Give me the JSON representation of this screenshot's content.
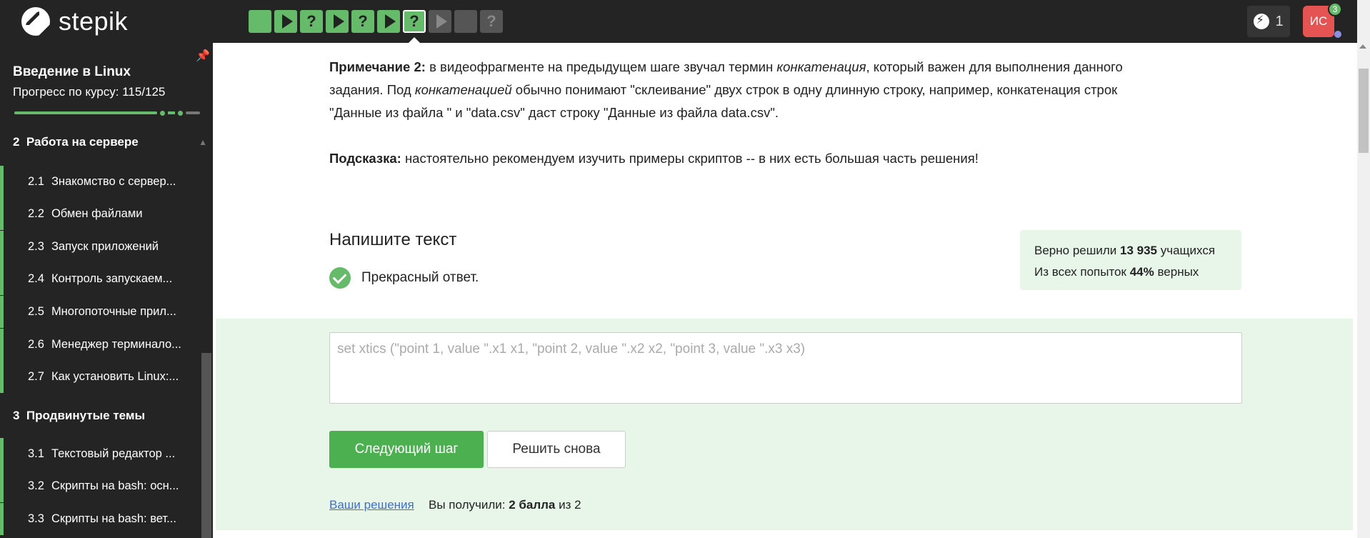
{
  "header": {
    "logo_text": "stepik",
    "steps": [
      {
        "kind": "square",
        "state": "green"
      },
      {
        "kind": "play",
        "state": "green"
      },
      {
        "kind": "question",
        "state": "green",
        "label": "?"
      },
      {
        "kind": "play",
        "state": "green"
      },
      {
        "kind": "question",
        "state": "green",
        "label": "?"
      },
      {
        "kind": "play",
        "state": "green"
      },
      {
        "kind": "question",
        "state": "current",
        "label": "?"
      },
      {
        "kind": "play",
        "state": "gray"
      },
      {
        "kind": "square",
        "state": "gray"
      },
      {
        "kind": "question",
        "state": "gray",
        "label": "?"
      }
    ],
    "energy_count": "1",
    "avatar_initials": "ИС",
    "notifications": "3"
  },
  "sidebar": {
    "course_title": "Введение в Linux",
    "progress_label": "Прогресс по курсу:  115/125",
    "progress_fraction": 0.92,
    "sections": [
      {
        "num": "2",
        "title": "Работа на сервере"
      },
      {
        "num": "3",
        "title": "Продвинутые темы"
      }
    ],
    "lessons": [
      {
        "num": "2.1",
        "title": "Знакомство с сервер..."
      },
      {
        "num": "2.2",
        "title": "Обмен файлами"
      },
      {
        "num": "2.3",
        "title": "Запуск приложений"
      },
      {
        "num": "2.4",
        "title": "Контроль запускаем..."
      },
      {
        "num": "2.5",
        "title": "Многопоточные прил..."
      },
      {
        "num": "2.6",
        "title": "Менеджер терминало..."
      },
      {
        "num": "2.7",
        "title": "Как установить Linux:..."
      },
      {
        "num": "3.1",
        "title": "Текстовый редактор ..."
      },
      {
        "num": "3.2",
        "title": "Скрипты на bash: осн..."
      },
      {
        "num": "3.3",
        "title": "Скрипты на bash: вет..."
      }
    ]
  },
  "main": {
    "note_label": "Примечание 2:",
    "note_p1": " в видеофрагменте на предыдущем шаге звучал термин ",
    "note_term1": "конкатенация",
    "note_p2": ", который важен для выполнения данного",
    "note_line2_a": "задания. Под ",
    "note_term2": "конкатенацией",
    "note_line2_b": " обычно понимают \"склеивание\" двух строк в одну длинную строку, например, конкатенация строк",
    "note_line3": "\"Данные из файла \" и \"data.csv\" даст строку \"Данные из файла data.csv\".",
    "hint_label": "Подсказка:",
    "hint_text": " настоятельно рекомендуем изучить примеры скриптов -- в них есть большая часть решения!",
    "task_heading": "Напишите текст",
    "result_text": "Прекрасный ответ.",
    "stats_solved_prefix": "Верно решили ",
    "stats_solved_count": "13 935",
    "stats_solved_suffix": " учащихся",
    "stats_attempts_prefix": "Из всех попыток ",
    "stats_attempts_percent": "44%",
    "stats_attempts_suffix": " верных",
    "answer_placeholder": "set xtics (\"point 1, value \".x1 x1, \"point 2, value \".x2 x2, \"point 3, value \".x3 x3)",
    "next_button": "Следующий шаг",
    "retry_button": "Решить снова",
    "solutions_link": "Ваши решения",
    "score_prefix": "Вы получили: ",
    "score_value": "2 балла",
    "score_suffix": " из 2"
  },
  "colors": {
    "accent_green": "#66bb6a",
    "dark_bg": "#242424",
    "success_bg": "#e8f5e9",
    "link_blue": "#3a6fd8"
  }
}
